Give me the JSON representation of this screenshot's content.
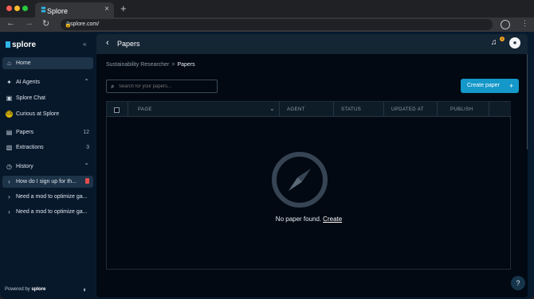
{
  "browser": {
    "tab_title": "Splore",
    "close_glyph": "×",
    "new_tab_glyph": "+",
    "url": "splore.com/",
    "back_glyph": "←",
    "forward_glyph": "→",
    "reload_glyph": "↻",
    "menu_glyph": "⋮"
  },
  "sidebar": {
    "logo": "splore",
    "collapse_glyph": "«",
    "items": [
      {
        "label": "Home",
        "icon": "home-icon",
        "glyph": "⌂"
      },
      {
        "label": "AI Agents",
        "icon": "ai-agents-icon",
        "glyph": "✦",
        "chevron": "⌃"
      },
      {
        "label": "Splore Chat",
        "icon": "splore-chat-icon",
        "glyph": "▣"
      },
      {
        "label": "Curious at Splore",
        "icon": "curious-avatar-icon",
        "glyph": "CS"
      },
      {
        "label": "Papers",
        "icon": "papers-icon",
        "glyph": "▤",
        "count": "12"
      },
      {
        "label": "Extractions",
        "icon": "extractions-icon",
        "glyph": "▧",
        "count": "3"
      },
      {
        "label": "History",
        "icon": "history-icon",
        "glyph": "◷",
        "chevron": "⌃"
      },
      {
        "label": "How do I sign up for th...",
        "icon": "caret-right-icon",
        "glyph": "›"
      },
      {
        "label": "Need a mod to optimize ga...",
        "icon": "caret-right-icon",
        "glyph": "›"
      },
      {
        "label": "Need a mod to optimize ga...",
        "icon": "caret-right-icon",
        "glyph": "›"
      }
    ],
    "powered_by": "Powered by",
    "powered_brand": "splore",
    "palette_glyph": "◐"
  },
  "header": {
    "back_glyph": "‹",
    "title": "Papers",
    "notification_glyph": "♫",
    "notification_count": "4",
    "user_glyph": "●"
  },
  "breadcrumb": {
    "parent": "Sustainability Researcher",
    "separator": ">",
    "current": "Papers"
  },
  "search": {
    "placeholder": "Search for your papers...",
    "icon_glyph": "⌕"
  },
  "create_button": {
    "label": "Create paper",
    "plus": "+"
  },
  "table": {
    "columns": [
      "PAGE",
      "AGENT",
      "STATUS",
      "UPDATED AT",
      "PUBLISH"
    ],
    "page_dropdown_glyph": "⌄",
    "empty_message": "No paper found.",
    "empty_link": "Create"
  },
  "help": {
    "glyph": "?"
  },
  "colors": {
    "accent": "#1497c9",
    "sidebar_bg": "#08182b",
    "main_bg": "#020913",
    "warning_badge": "#f5a623",
    "delete_icon": "#e34d4d"
  }
}
